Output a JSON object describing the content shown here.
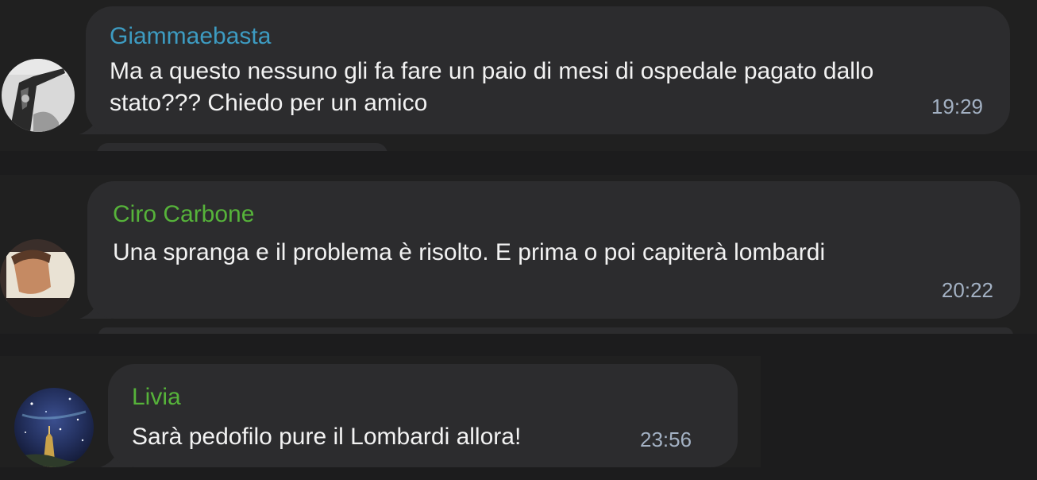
{
  "messages": [
    {
      "sender": "Giammaebasta",
      "sender_color": "#3d9bc1",
      "lines": [
        "Ma a questo nessuno gli fa fare un paio di mesi di ospedale pagato dallo",
        "stato??? Chiedo per un amico"
      ],
      "time": "19:29"
    },
    {
      "sender": "Ciro Carbone",
      "sender_color": "#56b33a",
      "lines": [
        "Una spranga e il problema è risolto. E prima o poi capiterà lombardi"
      ],
      "time": "20:22"
    },
    {
      "sender": "Livia",
      "sender_color": "#56b33a",
      "lines": [
        "Sarà pedofilo pure il Lombardi allora!"
      ],
      "time": "23:56"
    }
  ],
  "colors": {
    "background": "#1c1c1d",
    "panel": "#202020",
    "bubble": "#2c2c2e",
    "text": "#f2f2f2",
    "timestamp": "#a3b1c3"
  },
  "avatars": [
    "tattoo-photo-avatar",
    "portrait-photo-avatar",
    "night-sky-avatar"
  ]
}
